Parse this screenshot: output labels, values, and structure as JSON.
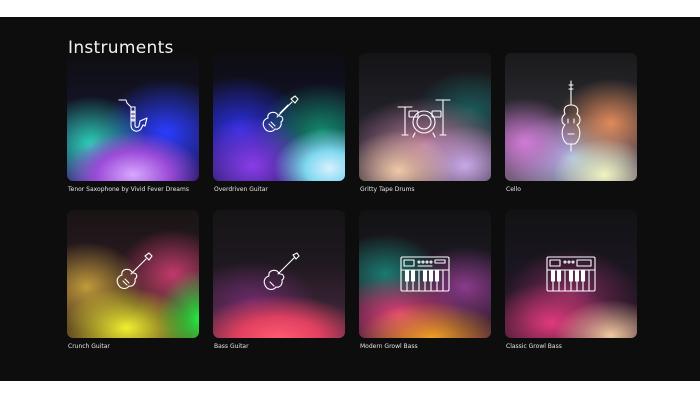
{
  "section": {
    "title": "Instruments"
  },
  "instruments": [
    {
      "label": "Tenor Saxophone by Vivid Fever Dreams",
      "icon": "saxophone-icon"
    },
    {
      "label": "Overdriven Guitar",
      "icon": "electric-guitar-icon"
    },
    {
      "label": "Gritty Tape Drums",
      "icon": "drum-kit-icon"
    },
    {
      "label": "Cello",
      "icon": "cello-icon"
    },
    {
      "label": "Crunch Guitar",
      "icon": "electric-guitar-icon"
    },
    {
      "label": "Bass Guitar",
      "icon": "bass-guitar-icon"
    },
    {
      "label": "Modern Growl Bass",
      "icon": "synthesizer-icon"
    },
    {
      "label": "Classic Growl Bass",
      "icon": "synthesizer-icon"
    }
  ],
  "colors": {
    "background": "#0d0d0d",
    "text": "#f2f2f2",
    "icon_stroke": "#ffffff"
  }
}
